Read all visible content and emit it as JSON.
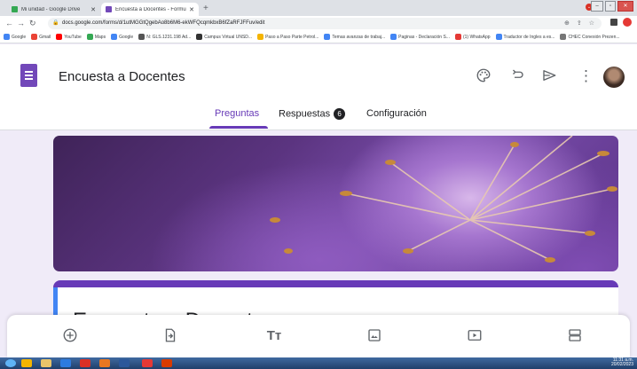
{
  "browser": {
    "tabs": [
      {
        "title": "Mi unidad - Google Drive",
        "favicon_color": "#34a853"
      },
      {
        "title": "Encuesta a Docentes - Formularios de G",
        "favicon_color": "#7248b9"
      }
    ],
    "new_tab": "+",
    "url": "docs.google.com/forms/d/1utMGGtQgebAo8b6M6-ekWFQcqmkbxB6fZaRFJFFuv/edit",
    "bookmarks": [
      {
        "label": "Google",
        "color": "#4285f4"
      },
      {
        "label": "Gmail",
        "color": "#ea4335"
      },
      {
        "label": "YouTube",
        "color": "#ff0000"
      },
      {
        "label": "Maps",
        "color": "#34a853"
      },
      {
        "label": "Google",
        "color": "#4285f4"
      },
      {
        "label": "N: GLS.1231.198 Ad...",
        "color": "#555555"
      },
      {
        "label": "Campus Virtual UNSD...",
        "color": "#333333"
      },
      {
        "label": "Paso a Paso Parte Petrol...",
        "color": "#f4b400"
      },
      {
        "label": "Temas avanzas de trabaj...",
        "color": "#4285f4"
      },
      {
        "label": "Paginas - Declaración S...",
        "color": "#4285f4"
      },
      {
        "label": "(1) WhatsApp",
        "color": "#e53935"
      },
      {
        "label": "Traductor de Ingles a es...",
        "color": "#4285f4"
      },
      {
        "label": "CHEC Conexión Prezen...",
        "color": "#777777"
      }
    ]
  },
  "forms": {
    "doc_title": "Encuesta a Docentes",
    "tabs": {
      "preguntas": "Preguntas",
      "respuestas": "Respuestas",
      "respuestas_count": "6",
      "configuracion": "Configuración"
    },
    "card_title": "Encuesta a Docentes",
    "accent": "#673ab7"
  },
  "taskbar": {
    "time": "11:31 a.m.",
    "date": "20/02/2023"
  }
}
